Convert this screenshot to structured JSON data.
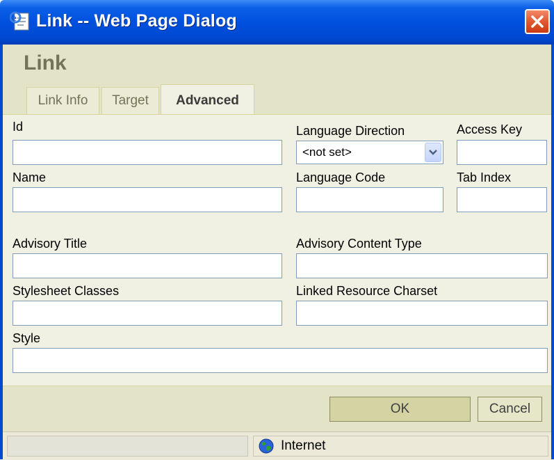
{
  "window": {
    "title": "Link -- Web Page Dialog",
    "heading": "Link"
  },
  "tabs": [
    {
      "label": "Link Info",
      "active": false
    },
    {
      "label": "Target",
      "active": false
    },
    {
      "label": "Advanced",
      "active": true
    }
  ],
  "fields": {
    "id": {
      "label": "Id",
      "value": ""
    },
    "language_direction": {
      "label": "Language Direction",
      "value": "<not set>"
    },
    "access_key": {
      "label": "Access Key",
      "value": ""
    },
    "name": {
      "label": "Name",
      "value": ""
    },
    "language_code": {
      "label": "Language Code",
      "value": ""
    },
    "tab_index": {
      "label": "Tab Index",
      "value": ""
    },
    "advisory_title": {
      "label": "Advisory Title",
      "value": ""
    },
    "advisory_content_type": {
      "label": "Advisory Content Type",
      "value": ""
    },
    "stylesheet_classes": {
      "label": "Stylesheet Classes",
      "value": ""
    },
    "linked_resource_charset": {
      "label": "Linked Resource Charset",
      "value": ""
    },
    "style": {
      "label": "Style",
      "value": ""
    }
  },
  "buttons": {
    "ok": "OK",
    "cancel": "Cancel"
  },
  "statusbar": {
    "left_text": "",
    "zone": "Internet"
  },
  "colors": {
    "titlebar": "#0050de",
    "panel": "#f1f1e3",
    "band": "#e3e3c7",
    "field_border": "#7f9db9"
  },
  "icons": {
    "title": "ie-page-icon",
    "close": "close-x-icon",
    "dropdown": "chevron-down-icon",
    "zone": "globe-icon"
  }
}
